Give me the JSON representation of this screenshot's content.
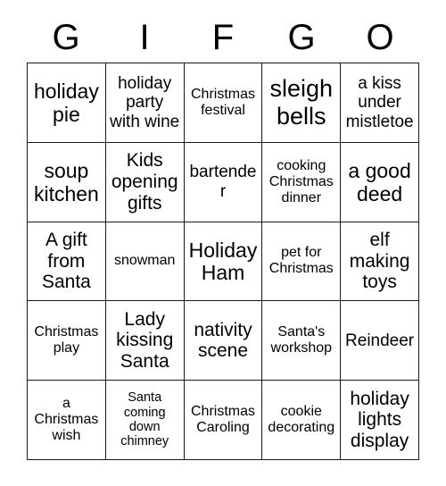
{
  "card": {
    "header": {
      "letters": [
        "G",
        "I",
        "F",
        "G",
        "O"
      ]
    },
    "grid": {
      "columns": 5,
      "rows": 5,
      "border_color": "#1a1a1a",
      "background_color": "#ffffff",
      "text_color": "#000000",
      "cells": [
        {
          "text": "holiday pie",
          "size": "xl"
        },
        {
          "text": "holiday party with wine",
          "size": "md"
        },
        {
          "text": "Christmas festival",
          "size": "sm"
        },
        {
          "text": "sleigh bells",
          "size": "xxl"
        },
        {
          "text": "a kiss under mistletoe",
          "size": "md"
        },
        {
          "text": "soup kitchen",
          "size": "xl"
        },
        {
          "text": "Kids opening gifts",
          "size": "lg"
        },
        {
          "text": "bartender",
          "size": "md"
        },
        {
          "text": "cooking Christmas dinner",
          "size": "sm"
        },
        {
          "text": "a good deed",
          "size": "xl"
        },
        {
          "text": "A gift from Santa",
          "size": "lg"
        },
        {
          "text": "snowman",
          "size": "sm"
        },
        {
          "text": "Holiday Ham",
          "size": "xl"
        },
        {
          "text": "pet for Christmas",
          "size": "sm"
        },
        {
          "text": "elf making toys",
          "size": "lg"
        },
        {
          "text": "Christmas play",
          "size": "sm"
        },
        {
          "text": "Lady kissing Santa",
          "size": "lg"
        },
        {
          "text": "nativity scene",
          "size": "lg"
        },
        {
          "text": "Santa's workshop",
          "size": "sm"
        },
        {
          "text": "Reindeer",
          "size": "md"
        },
        {
          "text": "a Christmas wish",
          "size": "sm"
        },
        {
          "text": "Santa coming down chimney",
          "size": "xs"
        },
        {
          "text": "Christmas Caroling",
          "size": "sm"
        },
        {
          "text": "cookie decorating",
          "size": "sm"
        },
        {
          "text": "holiday lights display",
          "size": "lg"
        }
      ]
    }
  }
}
